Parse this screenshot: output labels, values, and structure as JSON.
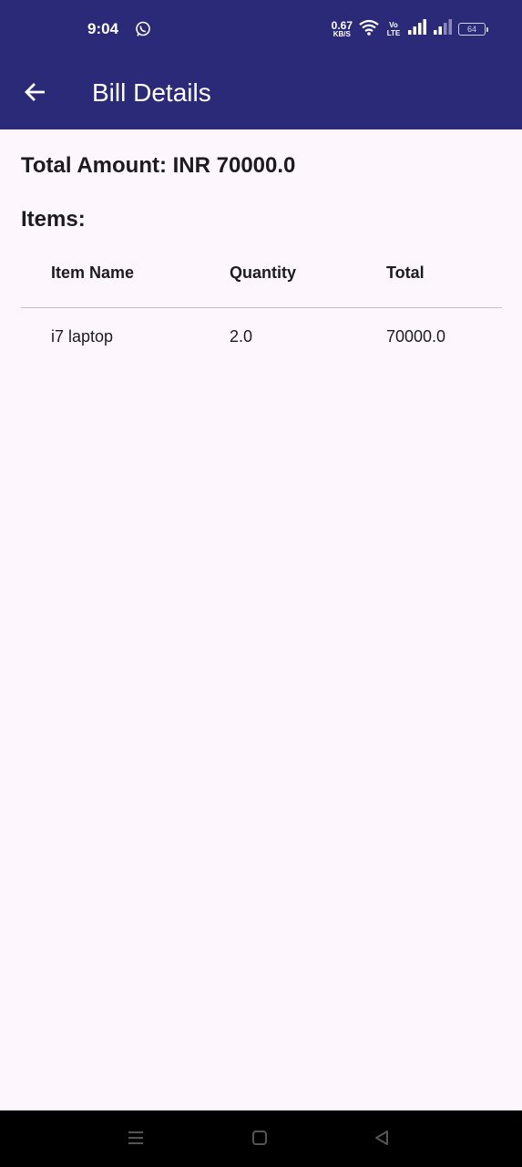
{
  "status_bar": {
    "time": "9:04",
    "net_speed_value": "0.67",
    "net_speed_unit": "KB/S",
    "volte_label": "Vo LTE",
    "battery_level": "64",
    "icons": [
      "whatsapp-icon",
      "wifi-icon",
      "volte-icon",
      "signal-icon",
      "signal-icon",
      "battery-icon"
    ]
  },
  "app_bar": {
    "title": "Bill Details",
    "back_icon": "arrow-back-icon"
  },
  "bill": {
    "total_amount_text": "Total Amount: INR 70000.0",
    "items_heading": "Items:",
    "columns": [
      "Item Name",
      "Quantity",
      "Total"
    ],
    "rows": [
      [
        "i7 laptop",
        "2.0",
        "70000.0"
      ]
    ]
  },
  "nav_bar": {
    "icons": [
      "menu-icon",
      "home-icon",
      "back-triangle-icon"
    ]
  },
  "colors": {
    "primary": "#2b2a79",
    "background": "#fdf7fd",
    "text": "#1c1b1f",
    "divider": "#c4c0c8",
    "nav_bar": "#000000"
  }
}
